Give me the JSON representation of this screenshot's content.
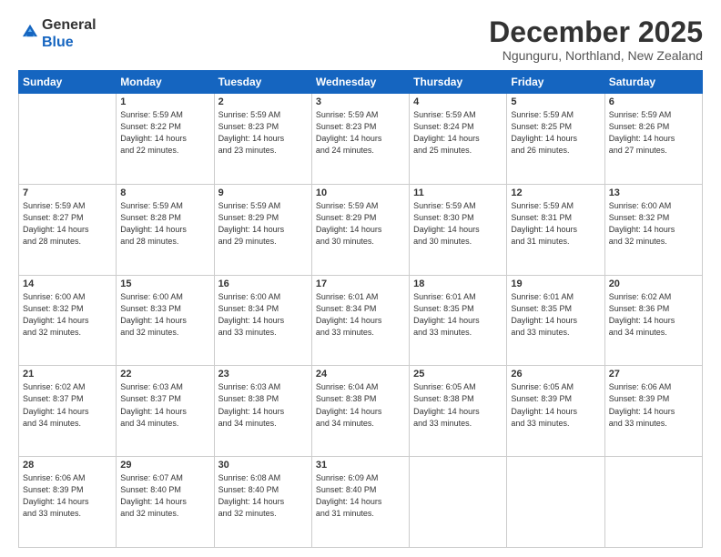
{
  "logo": {
    "general": "General",
    "blue": "Blue"
  },
  "header": {
    "month": "December 2025",
    "location": "Ngunguru, Northland, New Zealand"
  },
  "weekdays": [
    "Sunday",
    "Monday",
    "Tuesday",
    "Wednesday",
    "Thursday",
    "Friday",
    "Saturday"
  ],
  "weeks": [
    [
      {
        "day": "",
        "info": ""
      },
      {
        "day": "1",
        "info": "Sunrise: 5:59 AM\nSunset: 8:22 PM\nDaylight: 14 hours\nand 22 minutes."
      },
      {
        "day": "2",
        "info": "Sunrise: 5:59 AM\nSunset: 8:23 PM\nDaylight: 14 hours\nand 23 minutes."
      },
      {
        "day": "3",
        "info": "Sunrise: 5:59 AM\nSunset: 8:23 PM\nDaylight: 14 hours\nand 24 minutes."
      },
      {
        "day": "4",
        "info": "Sunrise: 5:59 AM\nSunset: 8:24 PM\nDaylight: 14 hours\nand 25 minutes."
      },
      {
        "day": "5",
        "info": "Sunrise: 5:59 AM\nSunset: 8:25 PM\nDaylight: 14 hours\nand 26 minutes."
      },
      {
        "day": "6",
        "info": "Sunrise: 5:59 AM\nSunset: 8:26 PM\nDaylight: 14 hours\nand 27 minutes."
      }
    ],
    [
      {
        "day": "7",
        "info": "Sunrise: 5:59 AM\nSunset: 8:27 PM\nDaylight: 14 hours\nand 28 minutes."
      },
      {
        "day": "8",
        "info": "Sunrise: 5:59 AM\nSunset: 8:28 PM\nDaylight: 14 hours\nand 28 minutes."
      },
      {
        "day": "9",
        "info": "Sunrise: 5:59 AM\nSunset: 8:29 PM\nDaylight: 14 hours\nand 29 minutes."
      },
      {
        "day": "10",
        "info": "Sunrise: 5:59 AM\nSunset: 8:29 PM\nDaylight: 14 hours\nand 30 minutes."
      },
      {
        "day": "11",
        "info": "Sunrise: 5:59 AM\nSunset: 8:30 PM\nDaylight: 14 hours\nand 30 minutes."
      },
      {
        "day": "12",
        "info": "Sunrise: 5:59 AM\nSunset: 8:31 PM\nDaylight: 14 hours\nand 31 minutes."
      },
      {
        "day": "13",
        "info": "Sunrise: 6:00 AM\nSunset: 8:32 PM\nDaylight: 14 hours\nand 32 minutes."
      }
    ],
    [
      {
        "day": "14",
        "info": "Sunrise: 6:00 AM\nSunset: 8:32 PM\nDaylight: 14 hours\nand 32 minutes."
      },
      {
        "day": "15",
        "info": "Sunrise: 6:00 AM\nSunset: 8:33 PM\nDaylight: 14 hours\nand 32 minutes."
      },
      {
        "day": "16",
        "info": "Sunrise: 6:00 AM\nSunset: 8:34 PM\nDaylight: 14 hours\nand 33 minutes."
      },
      {
        "day": "17",
        "info": "Sunrise: 6:01 AM\nSunset: 8:34 PM\nDaylight: 14 hours\nand 33 minutes."
      },
      {
        "day": "18",
        "info": "Sunrise: 6:01 AM\nSunset: 8:35 PM\nDaylight: 14 hours\nand 33 minutes."
      },
      {
        "day": "19",
        "info": "Sunrise: 6:01 AM\nSunset: 8:35 PM\nDaylight: 14 hours\nand 33 minutes."
      },
      {
        "day": "20",
        "info": "Sunrise: 6:02 AM\nSunset: 8:36 PM\nDaylight: 14 hours\nand 34 minutes."
      }
    ],
    [
      {
        "day": "21",
        "info": "Sunrise: 6:02 AM\nSunset: 8:37 PM\nDaylight: 14 hours\nand 34 minutes."
      },
      {
        "day": "22",
        "info": "Sunrise: 6:03 AM\nSunset: 8:37 PM\nDaylight: 14 hours\nand 34 minutes."
      },
      {
        "day": "23",
        "info": "Sunrise: 6:03 AM\nSunset: 8:38 PM\nDaylight: 14 hours\nand 34 minutes."
      },
      {
        "day": "24",
        "info": "Sunrise: 6:04 AM\nSunset: 8:38 PM\nDaylight: 14 hours\nand 34 minutes."
      },
      {
        "day": "25",
        "info": "Sunrise: 6:05 AM\nSunset: 8:38 PM\nDaylight: 14 hours\nand 33 minutes."
      },
      {
        "day": "26",
        "info": "Sunrise: 6:05 AM\nSunset: 8:39 PM\nDaylight: 14 hours\nand 33 minutes."
      },
      {
        "day": "27",
        "info": "Sunrise: 6:06 AM\nSunset: 8:39 PM\nDaylight: 14 hours\nand 33 minutes."
      }
    ],
    [
      {
        "day": "28",
        "info": "Sunrise: 6:06 AM\nSunset: 8:39 PM\nDaylight: 14 hours\nand 33 minutes."
      },
      {
        "day": "29",
        "info": "Sunrise: 6:07 AM\nSunset: 8:40 PM\nDaylight: 14 hours\nand 32 minutes."
      },
      {
        "day": "30",
        "info": "Sunrise: 6:08 AM\nSunset: 8:40 PM\nDaylight: 14 hours\nand 32 minutes."
      },
      {
        "day": "31",
        "info": "Sunrise: 6:09 AM\nSunset: 8:40 PM\nDaylight: 14 hours\nand 31 minutes."
      },
      {
        "day": "",
        "info": ""
      },
      {
        "day": "",
        "info": ""
      },
      {
        "day": "",
        "info": ""
      }
    ]
  ]
}
